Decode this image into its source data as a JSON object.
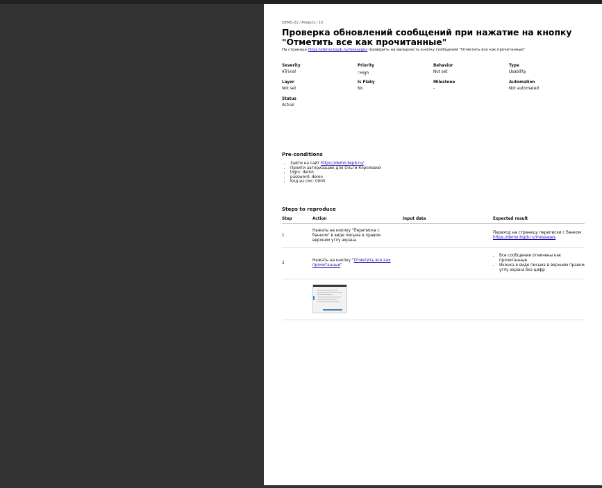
{
  "breadcrumb": "DEMO-21 / Projects / 15",
  "title": "Проверка обновлений сообщений при нажатие на кнопку \"Отметить все как прочитанные\"",
  "description": {
    "before": "На странице ",
    "link": "https://demo.bspb.ru/messages",
    "after": " проверить на валидность кнопку сообщений \"Отметить все как прочитанные\""
  },
  "meta": {
    "severity_label": "Severity",
    "severity_value": "Trivial",
    "priority_label": "Priority",
    "priority_value": "High",
    "behavior_label": "Behavior",
    "behavior_value": "Not set",
    "type_label": "Type",
    "type_value": "Usability",
    "layer_label": "Layer",
    "layer_value": "Not set",
    "flaky_label": "Is Flaky",
    "flaky_value": "No",
    "milestone_label": "Milestone",
    "milestone_value": "-",
    "automation_label": "Automation",
    "automation_value": "Not automated",
    "status_label": "Status",
    "status_value": "Actual"
  },
  "preconditions": {
    "heading": "Pre-conditions",
    "item1_text": "Зайти на сайт ",
    "item1_link": "https://demo.bspb.ru/",
    "item2": "Пройти авторизацию для Ольги Королевой",
    "item3": "login: demo",
    "item4": "password: demo",
    "item5": "Код из смс: 0000"
  },
  "steps": {
    "heading": "Steps to reproduce",
    "col_step": "Step",
    "col_action": "Action",
    "col_input": "Input data",
    "col_expected": "Expected result",
    "rows": [
      {
        "num": "1",
        "action": "Нажать на кнопку \"Переписка с банком\" в виде письма в правом верхнем углу экрана",
        "expected_text": "Переход на страницу переписки с банком ",
        "expected_link": "https://demo.bspb.ru/messages"
      },
      {
        "num": "2",
        "action_before": "Нажать на кнопку \"",
        "action_link": "Отметить все как прочитанные",
        "action_after": "\"",
        "expected_item1": "Все сообщения отмечены как прочитанные",
        "expected_item2": "Иконка в виде письма в верхнем правом углу экрана без цифр"
      }
    ]
  },
  "icons": {
    "severity": "double-chevron-down-icon",
    "priority": "arrow-up-icon"
  },
  "colors": {
    "priority_high": "#d32f2f",
    "link": "#1a0dab"
  }
}
